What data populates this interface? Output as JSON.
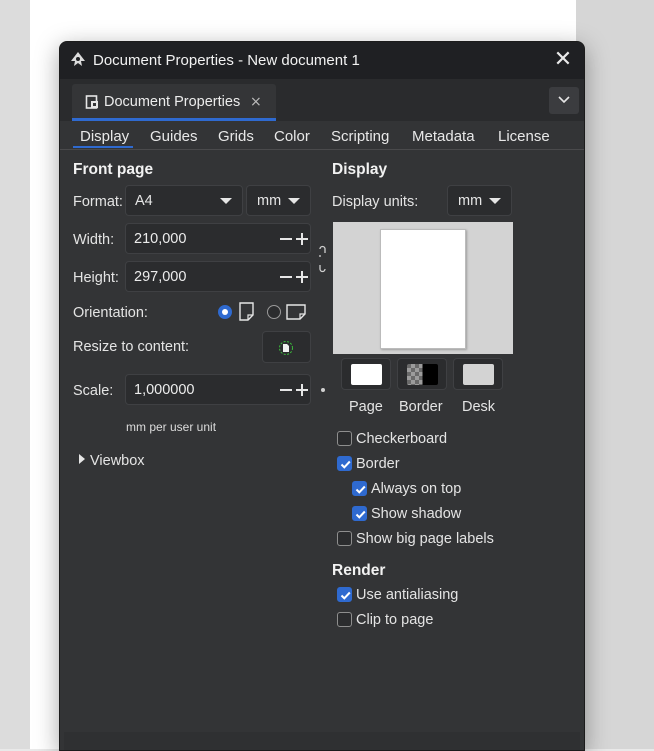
{
  "window": {
    "title": "Document Properties - New document 1"
  },
  "tab": {
    "label": "Document Properties",
    "close": "×"
  },
  "subtabs": [
    "Display",
    "Guides",
    "Grids",
    "Color",
    "Scripting",
    "Metadata",
    "License"
  ],
  "front_page": {
    "heading": "Front page",
    "format_label": "Format:",
    "format_value": "A4",
    "format_unit": "mm",
    "width_label": "Width:",
    "width_value": "210,000",
    "height_label": "Height:",
    "height_value": "297,000",
    "orientation_label": "Orientation:",
    "orientation_selected": "portrait",
    "resize_label": "Resize to content:",
    "scale_label": "Scale:",
    "scale_value": "1,000000",
    "scale_hint": "mm per user unit",
    "viewbox_label": "Viewbox"
  },
  "display": {
    "heading": "Display",
    "units_label": "Display units:",
    "units_value": "mm",
    "swatches": [
      {
        "label": "Page",
        "color": "#ffffff"
      },
      {
        "label": "Border",
        "color": "#000000"
      },
      {
        "label": "Desk",
        "color": "#d3d3d3"
      }
    ],
    "options": [
      {
        "label": "Checkerboard",
        "checked": false
      },
      {
        "label": "Border",
        "checked": true
      },
      {
        "label": "Always on top",
        "checked": true
      },
      {
        "label": "Show shadow",
        "checked": true
      },
      {
        "label": "Show big page labels",
        "checked": false
      }
    ]
  },
  "render": {
    "heading": "Render",
    "options": [
      {
        "label": "Use antialiasing",
        "checked": true
      },
      {
        "label": "Clip to page",
        "checked": false
      }
    ]
  },
  "colors": {
    "accent": "#2f6ad0",
    "panel": "#333436",
    "titlebar": "#1f2023"
  }
}
